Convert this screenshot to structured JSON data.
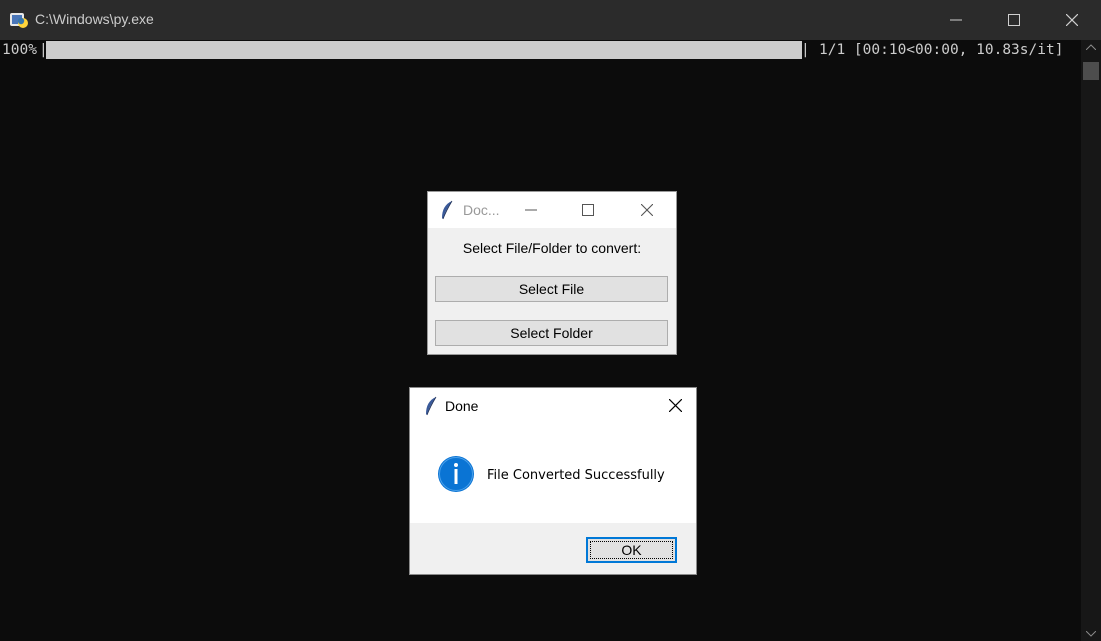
{
  "console": {
    "title": "C:\\Windows\\py.exe",
    "icon": "python-launcher-icon",
    "progress": {
      "percent_label": "100%",
      "bar_left": "|",
      "bar_right": "|",
      "fraction": 1.0,
      "stats": "1/1 [00:10<00:00, 10.83s/it]"
    },
    "controls": [
      "minimize-icon",
      "maximize-icon",
      "close-icon"
    ],
    "colors": {
      "background": "#0c0c0c",
      "titlebar": "#2b2b2b",
      "text": "#cccccc"
    }
  },
  "main_dialog": {
    "title": "Doc...",
    "icon": "tk-feather-icon",
    "prompt": "Select File/Folder to convert:",
    "buttons": {
      "select_file": "Select File",
      "select_folder": "Select Folder"
    }
  },
  "message_box": {
    "title": "Done",
    "icon": "info-icon",
    "message": "File Converted Successfully",
    "ok_label": "OK",
    "colors": {
      "info": "#0a74d4",
      "focus_border": "#0078d7"
    }
  }
}
